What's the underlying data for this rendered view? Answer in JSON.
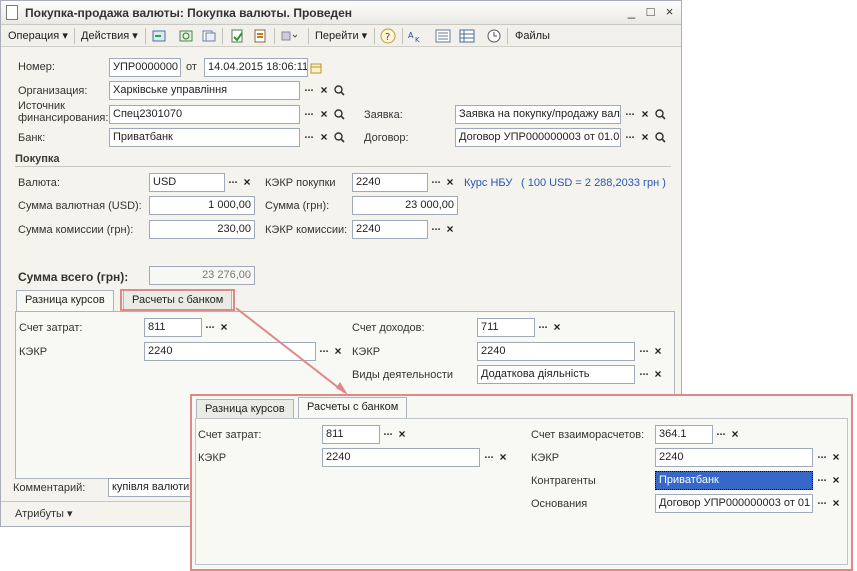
{
  "window": {
    "title": "Покупка-продажа валюты: Покупка валюты. Проведен",
    "controls": [
      "_",
      "□",
      "×"
    ]
  },
  "toolbar": {
    "operation": "Операция",
    "actions": "Действия",
    "goto": "Перейти",
    "files": "Файлы"
  },
  "header": {
    "number_label": "Номер:",
    "number": "УПР0000000",
    "from_label": "от",
    "date": "14.04.2015 18:06:11",
    "org_label": "Организация:",
    "org": "Харківське управління",
    "source_label": "Источник финансирования:",
    "source": "Спец2301070",
    "bank_label": "Банк:",
    "bank": "Приватбанк",
    "request_label": "Заявка:",
    "request": "Заявка на покупку/продажу вал",
    "contract_label": "Договор:",
    "contract": "Договор УПР000000003 от 01.0"
  },
  "purchase": {
    "section_title": "Покупка",
    "currency_label": "Валюта:",
    "currency": "USD",
    "kekr_buy_label": "КЭКР покупки",
    "kekr_buy": "2240",
    "rate_link": "Курс НБУ",
    "rate_text": "( 100 USD = 2 288,2033 грн )",
    "sum_cur_label": "Сумма валютная (USD):",
    "sum_cur": "1 000,00",
    "sum_uah_label": "Сумма (грн):",
    "sum_uah": "23 000,00",
    "commission_label": "Сумма комиссии (грн):",
    "commission": "230,00",
    "kekr_comm_label": "КЭКР комиссии:",
    "kekr_comm": "2240",
    "total_label": "Сумма всего (грн):",
    "total": "23 276,00"
  },
  "tabs": {
    "tab1": "Разница курсов",
    "tab2": "Расчеты с банком"
  },
  "diff_panel": {
    "cost_acc_label": "Счет затрат:",
    "cost_acc": "811",
    "kekr_label": "КЭКР",
    "kekr": "2240",
    "income_acc_label": "Счет доходов:",
    "income_acc": "711",
    "kekr2_label": "КЭКР",
    "kekr2": "2240",
    "activity_label": "Виды деятельности",
    "activity": "Додаткова діяльність"
  },
  "footer": {
    "comment_label": "Комментарий:",
    "comment": "купівля валюти",
    "attributes": "Атрибуты"
  },
  "zoom_panel": {
    "tab1": "Разница курсов",
    "tab2": "Расчеты с банком",
    "cost_acc_label": "Счет затрат:",
    "cost_acc": "811",
    "kekr_label": "КЭКР",
    "kekr": "2240",
    "settle_acc_label": "Счет взаиморасчетов:",
    "settle_acc": "364.1",
    "kekr2_label": "КЭКР",
    "kekr2": "2240",
    "counterparty_label": "Контрагенты",
    "counterparty": "Приватбанк",
    "basis_label": "Основания",
    "basis": "Договор УПР000000003 от 01"
  },
  "colors": {
    "highlight": "#e08888",
    "link": "#2a56b3",
    "selected": "#3568c8"
  }
}
